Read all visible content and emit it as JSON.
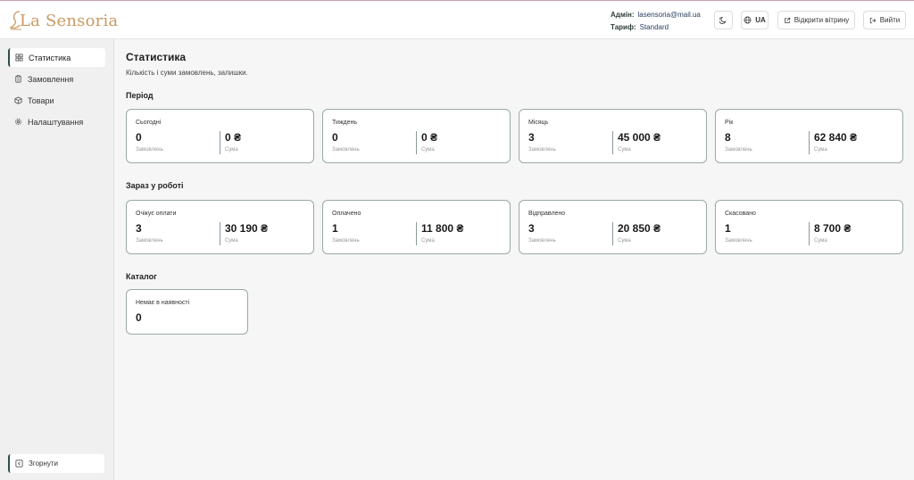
{
  "brand": {
    "logo_text": "La Sensoria"
  },
  "header": {
    "admin_label": "Адмін:",
    "admin_value": "lasensoria@mail.ua",
    "plan_label": "Тариф:",
    "plan_value": "Standard",
    "lang_label": "UA",
    "open_store_label": "Відкрити вітрину",
    "logout_label": "Вийти"
  },
  "sidebar": {
    "items": [
      {
        "label": "Статистика",
        "icon": "dashboard-icon",
        "active": true
      },
      {
        "label": "Замовлення",
        "icon": "clipboard-icon"
      },
      {
        "label": "Товари",
        "icon": "box-icon"
      },
      {
        "label": "Налаштування",
        "icon": "gear-icon"
      }
    ],
    "collapse_label": "Згорнути"
  },
  "main": {
    "title": "Статистика",
    "subtitle": "Кількість і суми замовлень, залишки.",
    "sections": [
      {
        "title": "Період",
        "cards": [
          {
            "label": "Сьогодні",
            "orders": "0",
            "orders_caption": "Замовлень",
            "sum": "0 ₴",
            "sum_caption": "Сума"
          },
          {
            "label": "Тиждень",
            "orders": "0",
            "orders_caption": "Замовлень",
            "sum": "0 ₴",
            "sum_caption": "Сума"
          },
          {
            "label": "Місяць",
            "orders": "3",
            "orders_caption": "Замовлень",
            "sum": "45 000 ₴",
            "sum_caption": "Сума"
          },
          {
            "label": "Рік",
            "orders": "8",
            "orders_caption": "Замовлень",
            "sum": "62 840 ₴",
            "sum_caption": "Сума"
          }
        ]
      },
      {
        "title": "Зараз у роботі",
        "cards": [
          {
            "label": "Очікує оплати",
            "orders": "3",
            "orders_caption": "Замовлень",
            "sum": "30 190 ₴",
            "sum_caption": "Сума"
          },
          {
            "label": "Оплачено",
            "orders": "1",
            "orders_caption": "Замовлень",
            "sum": "11 800 ₴",
            "sum_caption": "Сума"
          },
          {
            "label": "Відправлено",
            "orders": "3",
            "orders_caption": "Замовлень",
            "sum": "20 850 ₴",
            "sum_caption": "Сума"
          },
          {
            "label": "Скасовано",
            "orders": "1",
            "orders_caption": "Замовлень",
            "sum": "8 700 ₴",
            "sum_caption": "Сума"
          }
        ]
      },
      {
        "title": "Каталог",
        "cards": [
          {
            "label": "Немає в наявності",
            "value": "0"
          }
        ]
      }
    ]
  },
  "colors": {
    "brand_gold": "#c99a62",
    "accent_dark_green": "#2f4f4a",
    "card_border": "#9aa9a6"
  }
}
